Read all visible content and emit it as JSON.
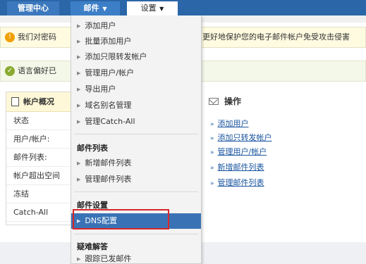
{
  "nav": {
    "admin_tab": "管理中心",
    "mail_tab": "邮件",
    "settings_tab": "设置"
  },
  "notices": {
    "security_left": "我们对密码",
    "security_right": "更好地保护您的电子邮件帐户免受攻击侵害",
    "language": "语言偏好已"
  },
  "account_panel": {
    "title": "帐户概况",
    "rows": [
      "状态",
      "用户/帐户:",
      "邮件列表:",
      "帐户超出空间",
      "冻结",
      "Catch-All"
    ]
  },
  "dropdown": {
    "users_items": [
      "添加用户",
      "批量添加用户",
      "添加只限转发帐户",
      "管理用户/帐户",
      "导出用户",
      "域名别名管理",
      "管理Catch-All"
    ],
    "mail_list_heading": "邮件列表",
    "mail_list_items": [
      "新增邮件列表",
      "管理邮件列表"
    ],
    "mail_settings_heading": "邮件设置",
    "mail_settings_items": [
      "DNS配置"
    ],
    "troubleshoot_heading": "疑难解答",
    "troubleshoot_items": [
      "跟踪已发邮件"
    ]
  },
  "operations": {
    "title": "操作",
    "links": [
      "添加用户",
      "添加只转发帐户",
      "管理用户/帐户",
      "新增邮件列表",
      "管理邮件列表"
    ]
  }
}
